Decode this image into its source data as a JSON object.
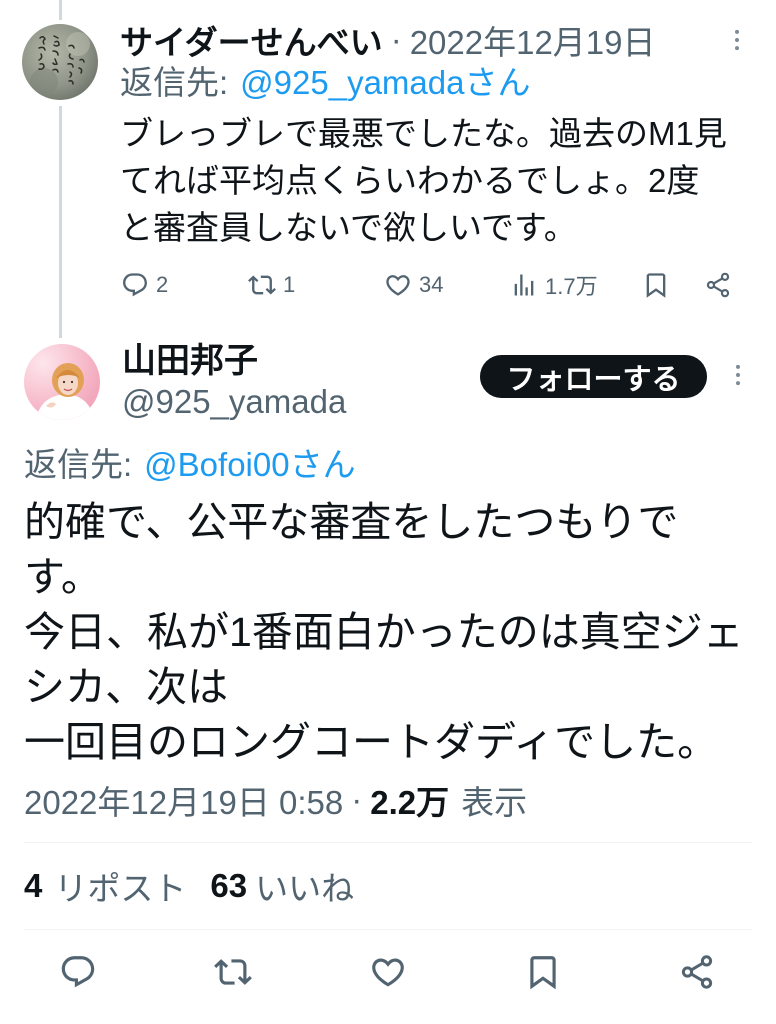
{
  "colors": {
    "text": "#0f1419",
    "secondary": "#536471",
    "link": "#1d9bf0",
    "divider": "#eff3f4",
    "thread_line": "#cfd9de",
    "follow_button_bg": "#0f1419",
    "follow_button_text": "#ffffff"
  },
  "reply_tweet": {
    "author_name": "サイダーせんべい",
    "separator": "·",
    "date": "2022年12月19日",
    "reply_to_label": "返信先:",
    "reply_to_handle": "@925_yamadaさん",
    "text_lines": [
      "ブレっブレで最悪でしたな。過去のM1見",
      "てれば平均点くらいわかるでしょ。2度",
      "と審査員しないで欲しいです。"
    ],
    "actions": {
      "replies": "2",
      "reposts": "1",
      "likes": "34",
      "views": "1.7万"
    }
  },
  "main_tweet": {
    "author_name": "山田邦子",
    "handle": "@925_yamada",
    "follow_label": "フォローする",
    "reply_to_label": "返信先:",
    "reply_to_handle": "@Bofoi00さん",
    "text_lines": [
      "的確で、公平な審査をしたつもりで",
      "す。",
      "今日、私が1番面白かったのは真空ジェ",
      "シカ、次は",
      "一回目のロングコートダディでした。"
    ],
    "timestamp": "2022年12月19日 0:58",
    "separator": "·",
    "views_count": "2.2万",
    "views_label": "表示",
    "reposts_count": "4",
    "reposts_label": "リポスト",
    "likes_count": "63",
    "likes_label": "いいね"
  },
  "icons": {
    "more": "more-vertical-icon",
    "reply": "reply-icon",
    "repost": "repost-icon",
    "like": "heart-icon",
    "views": "views-icon",
    "bookmark": "bookmark-icon",
    "share": "share-icon"
  }
}
